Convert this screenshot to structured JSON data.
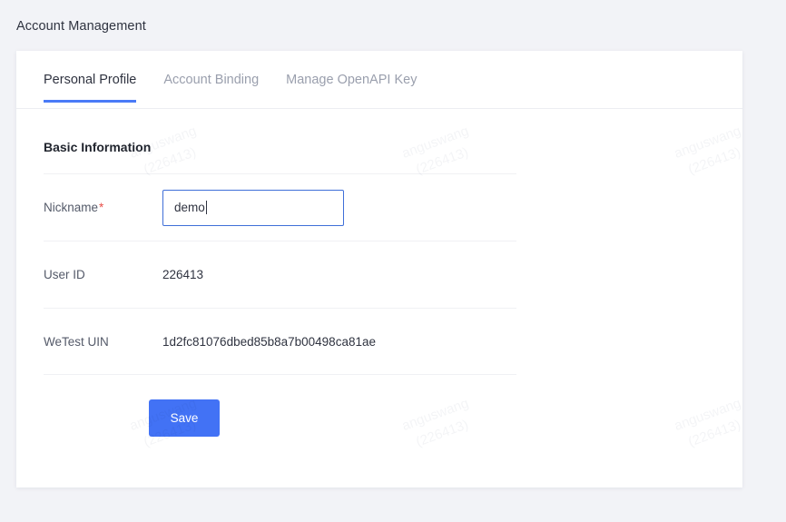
{
  "page": {
    "header_title": "Account Management",
    "background_color": "#f2f3f7"
  },
  "watermark": {
    "line1": "anguswang",
    "line2": "(226413)"
  },
  "tabs": [
    {
      "label": "Personal Profile",
      "active": true
    },
    {
      "label": "Account Binding",
      "active": false
    },
    {
      "label": "Manage OpenAPI Key",
      "active": false
    }
  ],
  "section": {
    "title": "Basic Information"
  },
  "form": {
    "nickname": {
      "label": "Nickname",
      "required_marker": "*",
      "value": "demo",
      "placeholder": ""
    },
    "user_id": {
      "label": "User ID",
      "value": "226413"
    },
    "wetest_uin": {
      "label": "WeTest UIN",
      "value": "1d2fc81076dbed85b8a7b00498ca81ae"
    }
  },
  "actions": {
    "save_label": "Save"
  },
  "colors": {
    "accent": "#4272f5",
    "tab_active_underline": "#4a7bf7",
    "input_focus_border": "#3f6fd8",
    "required_star": "#e8504a"
  }
}
